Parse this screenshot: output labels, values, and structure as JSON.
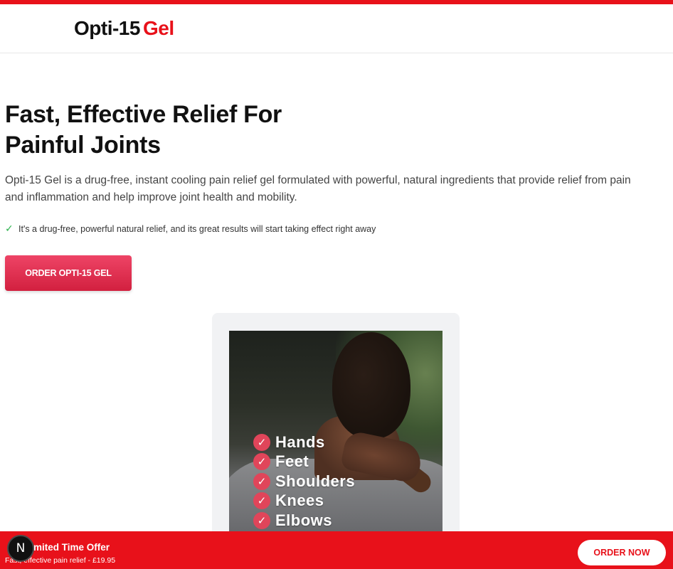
{
  "colors": {
    "brand_red": "#e8111a",
    "cta_gradient_top": "#ee4466",
    "cta_gradient_bottom": "#d2203f",
    "check_green": "#2bb24c",
    "tick_badge": "#e0455a"
  },
  "header": {
    "logo_brand": "Opti-15",
    "logo_accent": "Gel"
  },
  "hero": {
    "title": "Fast, Effective Relief For Painful Joints",
    "description": "Opti-15 Gel is a drug-free, instant cooling pain relief gel formulated with powerful, natural ingredients that provide relief from pain and inflammation and help improve joint health and mobility.",
    "feature_icon": "check-icon",
    "feature_text": "It's a drug-free, powerful natural relief, and its great results will start taking effect right away",
    "cta_label": "ORDER OPTI-15 GEL"
  },
  "image_card": {
    "body_parts": [
      "Hands",
      "Feet",
      "Shoulders",
      "Knees",
      "Elbows"
    ],
    "tick_icon": "check-circle-icon"
  },
  "offer_bar": {
    "title": "Limited Time Offer",
    "subtitle": "Fast, effective pain relief - £19.95",
    "button_label": "ORDER NOW"
  },
  "avatar": {
    "letter": "N"
  }
}
